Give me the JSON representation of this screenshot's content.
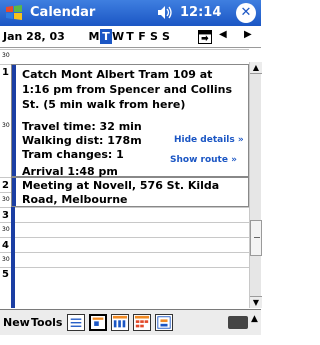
{
  "titlebar": {
    "app_title": "Calendar",
    "time": "12:14",
    "close": "✕"
  },
  "datebar": {
    "date": "Jan 28, 03",
    "weekdays": [
      "M",
      "T",
      "W",
      "T",
      "F",
      "S",
      "S"
    ],
    "selected_index": 1
  },
  "hours": [
    "1",
    "2",
    "3",
    "4",
    "5"
  ],
  "half_marker": "30",
  "appointments": [
    {
      "lines": [
        "Catch Mont Albert Tram 109 at",
        "1:16 pm from Spencer and Collins",
        "St. (5 min walk from here)"
      ],
      "details": [
        "Travel time: 32 min",
        "Walking dist: 178m",
        "Tram changes: 1"
      ],
      "arrival": "Arrival 1:48 pm",
      "hide_details": "Hide details »",
      "show_route": "Show route »"
    },
    {
      "lines": [
        "Meeting at Novell, 576 St. Kilda",
        "Road, Melbourne"
      ]
    }
  ],
  "toolbar": {
    "new_label": "New",
    "tools_label": "Tools"
  },
  "scroll": {
    "up": "▲",
    "down": "▼"
  }
}
